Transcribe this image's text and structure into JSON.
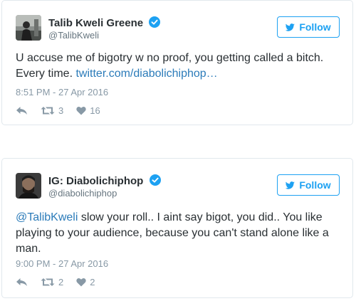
{
  "colors": {
    "accent": "#1da1f2",
    "verified": "#1da1f2",
    "link": "#2b7bb9",
    "muted": "#8899a6"
  },
  "tweets": [
    {
      "name": "Talib Kweli Greene",
      "handle": "@TalibKweli",
      "follow_label": "Follow",
      "text": "U accuse me of bigotry w no proof, you getting called a bitch. Every time. ",
      "link": "twitter.com/diabolichiphop…",
      "timestamp": "8:51 PM - 27 Apr 2016",
      "retweets": "3",
      "likes": "16",
      "avatar_icon": "avatar-photo"
    },
    {
      "name": "IG: Diabolichiphop",
      "handle": "@diabolichiphop",
      "follow_label": "Follow",
      "mention": "@TalibKweli",
      "text": " slow your roll.. I aint say bigot, you did.. You like playing to your audience, because you can't stand alone like a man.",
      "timestamp": "9:00 PM - 27 Apr 2016",
      "retweets": "2",
      "likes": "2",
      "avatar_icon": "avatar-photo"
    }
  ]
}
